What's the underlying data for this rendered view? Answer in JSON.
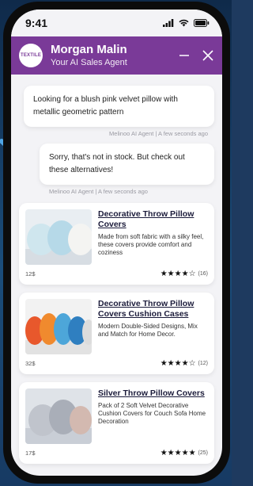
{
  "status": {
    "time": "9:41"
  },
  "header": {
    "logo_text": "TEXTILE",
    "name": "Morgan Malin",
    "subtitle": "Your AI Sales Agent",
    "minimize": "minimize",
    "close": "close"
  },
  "messages": [
    {
      "text": "Looking for a blush pink velvet pillow with metallic geometric pattern",
      "meta": "Melinoo AI Agent | A few seconds ago"
    },
    {
      "text": "Sorry, that's not in stock. But check out these alternatives!",
      "meta": "Melinoo AI Agent | A few seconds ago"
    }
  ],
  "products": [
    {
      "title": "Decorative Throw Pillow Covers",
      "desc": "Made from soft fabric with a silky feel, these covers provide comfort and coziness",
      "price": "12$",
      "rating": 4,
      "reviews": "(16)"
    },
    {
      "title": "Decorative Throw Pillow Covers Cushion Cases",
      "desc": "Modern Double-Sided Designs, Mix and Match for Home Decor.",
      "price": "32$",
      "rating": 4,
      "reviews": "(12)"
    },
    {
      "title": "Silver Throw Pillow Covers",
      "desc": "Pack of 2 Soft Velvet Decorative Cushion Covers for Couch Sofa Home Decoration",
      "price": "17$",
      "rating": 5,
      "reviews": "(25)"
    }
  ],
  "colors": {
    "header": "#7a3a98",
    "arrow": "#4fa6e6"
  }
}
